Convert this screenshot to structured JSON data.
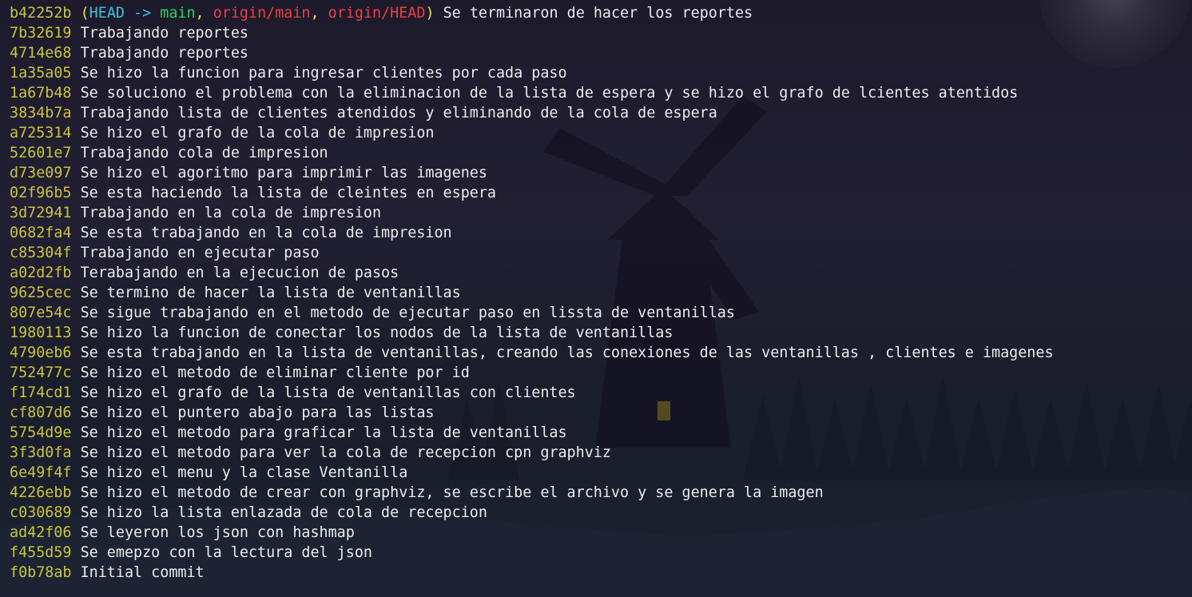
{
  "terminal": {
    "head_commit": {
      "hash": "b42252b",
      "head_label": "HEAD -> ",
      "local_branch": "main",
      "remote_branch_1": "origin/main",
      "remote_branch_2": "origin/HEAD",
      "message": "Se terminaron de hacer los reportes"
    },
    "commits": [
      {
        "hash": "7b32619",
        "message": "Trabajando reportes"
      },
      {
        "hash": "4714e68",
        "message": "Trabajando reportes"
      },
      {
        "hash": "1a35a05",
        "message": "Se hizo la funcion para ingresar clientes por cada paso"
      },
      {
        "hash": "1a67b48",
        "message": "Se soluciono el problema con la eliminacion de la lista de espera y se hizo el grafo de lcientes atentidos"
      },
      {
        "hash": "3834b7a",
        "message": "Trabajando lista de clientes atendidos y eliminando de la cola de espera"
      },
      {
        "hash": "a725314",
        "message": "Se hizo el grafo de la cola de impresion"
      },
      {
        "hash": "52601e7",
        "message": "Trabajando cola de impresion"
      },
      {
        "hash": "d73e097",
        "message": "Se hizo el agoritmo para imprimir las imagenes"
      },
      {
        "hash": "02f96b5",
        "message": "Se esta haciendo la lista de cleintes en espera"
      },
      {
        "hash": "3d72941",
        "message": "Trabajando en la cola de impresion"
      },
      {
        "hash": "0682fa4",
        "message": "Se esta trabajando en la cola de impresion"
      },
      {
        "hash": "c85304f",
        "message": "Trabajando en ejecutar paso"
      },
      {
        "hash": "a02d2fb",
        "message": "Terabajando en la ejecucion de pasos"
      },
      {
        "hash": "9625cec",
        "message": "Se termino de hacer la lista de ventanillas"
      },
      {
        "hash": "807e54c",
        "message": "Se sigue trabajando en el metodo de ejecutar paso en lissta de ventanillas"
      },
      {
        "hash": "1980113",
        "message": "Se hizo la funcion de conectar los nodos de la lista de ventanillas"
      },
      {
        "hash": "4790eb6",
        "message": "Se esta trabajando en la lista de ventanillas, creando las conexiones de las ventanillas , clientes e imagenes"
      },
      {
        "hash": "752477c",
        "message": "Se hizo el metodo de eliminar cliente por id"
      },
      {
        "hash": "f174cd1",
        "message": "Se hizo el grafo de la lista de ventanillas con clientes"
      },
      {
        "hash": "cf807d6",
        "message": "Se hizo el puntero abajo para las listas"
      },
      {
        "hash": "5754d9e",
        "message": "Se hizo el metodo para graficar la lista de ventanillas"
      },
      {
        "hash": "3f3d0fa",
        "message": "Se hizo el metodo para ver la cola de recepcion cpn graphviz"
      },
      {
        "hash": "6e49f4f",
        "message": "Se hizo el menu y la clase Ventanilla"
      },
      {
        "hash": "4226ebb",
        "message": "Se hizo el metodo de crear con graphviz, se escribe el archivo y se genera la imagen"
      },
      {
        "hash": "c030689",
        "message": "Se hizo la lista enlazada de cola de recepcion"
      },
      {
        "hash": "ad42f06",
        "message": "Se leyeron los json con hashmap"
      },
      {
        "hash": "f455d59",
        "message": "Se emepzo con la lectura del json"
      },
      {
        "hash": "f0b78ab",
        "message": "Initial commit"
      }
    ]
  },
  "colors": {
    "hash": "#c9c53c",
    "head": "#3ec3d6",
    "local_branch": "#2fd15a",
    "remote_branch": "#ef3f3f",
    "text": "#ececec"
  }
}
